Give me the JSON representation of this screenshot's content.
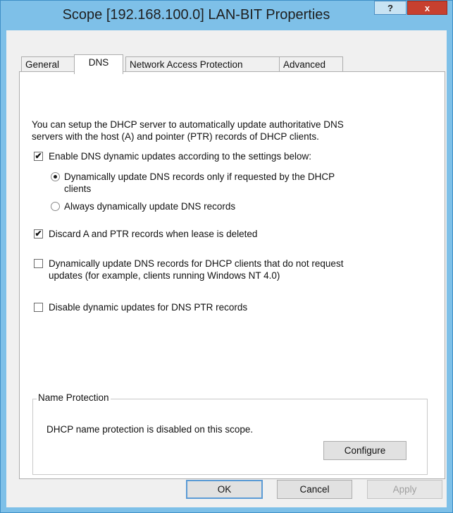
{
  "window": {
    "title": "Scope [192.168.100.0] LAN-BIT Properties",
    "help_label": "?",
    "close_label": "x"
  },
  "tabs": [
    {
      "label": "General"
    },
    {
      "label": "DNS"
    },
    {
      "label": "Network Access Protection"
    },
    {
      "label": "Advanced"
    }
  ],
  "active_tab": "DNS",
  "dns": {
    "intro_line1": "You can setup the DHCP server to automatically update authoritative DNS",
    "intro_line2": "servers with the host (A) and pointer (PTR) records of DHCP clients.",
    "enable_updates": {
      "label": "Enable DNS dynamic updates according to the settings below:",
      "checked": true,
      "mark": "✔"
    },
    "update_mode": {
      "selected": "requested",
      "requested_line1": "Dynamically update DNS records only if requested by the DHCP",
      "requested_line2": "clients",
      "always": "Always dynamically update DNS records"
    },
    "discard_records": {
      "label": "Discard A and PTR records when lease is deleted",
      "checked": true,
      "mark": "✔"
    },
    "update_non_requesting": {
      "label_line1": "Dynamically update DNS records for DHCP clients that do not request",
      "label_line2": "updates (for example, clients running Windows NT 4.0)",
      "checked": false,
      "mark": ""
    },
    "disable_ptr": {
      "label": "Disable dynamic updates for DNS PTR records",
      "checked": false,
      "mark": ""
    }
  },
  "name_protection": {
    "legend": "Name Protection",
    "status": "DHCP name protection is disabled on this scope.",
    "configure_label": "Configure"
  },
  "buttons": {
    "ok": "OK",
    "cancel": "Cancel",
    "apply": "Apply",
    "apply_enabled": false
  }
}
